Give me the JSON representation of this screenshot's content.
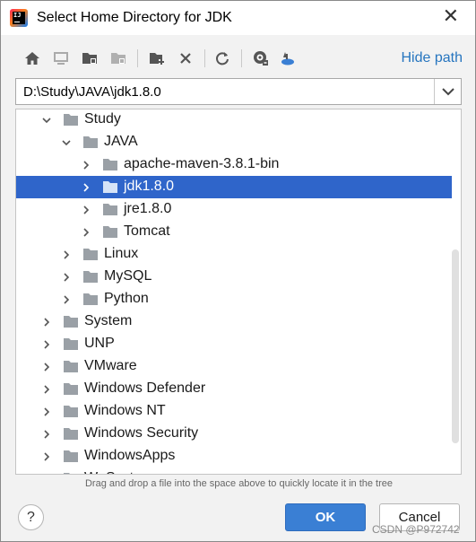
{
  "window": {
    "title": "Select Home Directory for JDK"
  },
  "toolbar": {
    "icons": [
      "home-icon",
      "desktop-icon",
      "project-folder-icon",
      "module-folder-icon",
      "new-folder-icon",
      "delete-icon",
      "refresh-icon",
      "hide-show-icon",
      "wsl-icon"
    ],
    "hide_path_label": "Hide path"
  },
  "path": {
    "value": "D:\\Study\\JAVA\\jdk1.8.0"
  },
  "tree": {
    "rows": [
      {
        "label": "Study",
        "level": 1,
        "expanded": true,
        "selected": false
      },
      {
        "label": "JAVA",
        "level": 2,
        "expanded": true,
        "selected": false
      },
      {
        "label": "apache-maven-3.8.1-bin",
        "level": 3,
        "expanded": false,
        "selected": false
      },
      {
        "label": "jdk1.8.0",
        "level": 3,
        "expanded": false,
        "selected": true
      },
      {
        "label": "jre1.8.0",
        "level": 3,
        "expanded": false,
        "selected": false
      },
      {
        "label": "Tomcat",
        "level": 3,
        "expanded": false,
        "selected": false
      },
      {
        "label": "Linux",
        "level": 2,
        "expanded": false,
        "selected": false
      },
      {
        "label": "MySQL",
        "level": 2,
        "expanded": false,
        "selected": false
      },
      {
        "label": "Python",
        "level": 2,
        "expanded": false,
        "selected": false
      },
      {
        "label": "System",
        "level": 1,
        "expanded": false,
        "selected": false
      },
      {
        "label": "UNP",
        "level": 1,
        "expanded": false,
        "selected": false
      },
      {
        "label": "VMware",
        "level": 1,
        "expanded": false,
        "selected": false
      },
      {
        "label": "Windows Defender",
        "level": 1,
        "expanded": false,
        "selected": false
      },
      {
        "label": "Windows NT",
        "level": 1,
        "expanded": false,
        "selected": false
      },
      {
        "label": "Windows Security",
        "level": 1,
        "expanded": false,
        "selected": false
      },
      {
        "label": "WindowsApps",
        "level": 1,
        "expanded": false,
        "selected": false
      },
      {
        "label": "WpSystem",
        "level": 1,
        "expanded": false,
        "selected": false
      }
    ]
  },
  "hint": "Drag and drop a file into the space above to quickly locate it in the tree",
  "buttons": {
    "help": "?",
    "ok": "OK",
    "cancel": "Cancel"
  },
  "watermark": "CSDN @P972742",
  "colors": {
    "selection": "#2f65ca",
    "link": "#2675bf",
    "ok_button": "#3a7fd4"
  }
}
